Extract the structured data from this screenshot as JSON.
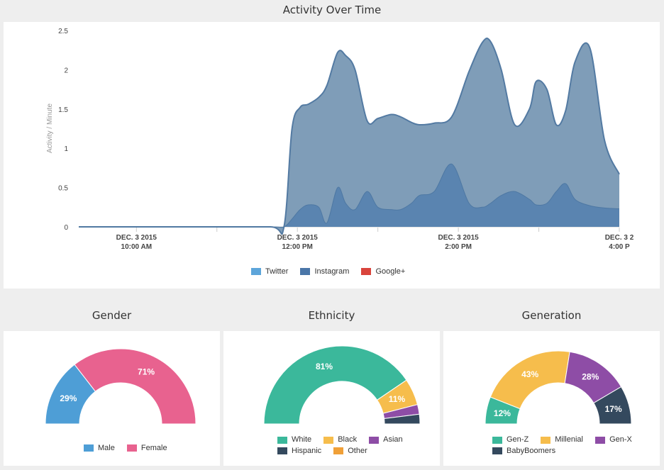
{
  "header": {
    "activity_title": "Activity Over Time"
  },
  "panels": {
    "gender_title": "Gender",
    "ethnicity_title": "Ethnicity",
    "generation_title": "Generation"
  },
  "chart_data": [
    {
      "type": "area",
      "title": "Activity Over Time",
      "ylabel": "Activity / Minute",
      "xlabel": "",
      "ylim": [
        0,
        2.5
      ],
      "yticks": [
        "0",
        "0.5",
        "1",
        "1.5",
        "2",
        "2.5"
      ],
      "xticks": [
        {
          "line1": "DEC. 3 2015",
          "line2": "10:00 AM",
          "t": 0
        },
        {
          "line1": "DEC. 3 2015",
          "line2": "12:00 PM",
          "t": 120
        },
        {
          "line1": "DEC. 3 2015",
          "line2": "2:00 PM",
          "t": 240
        },
        {
          "line1": "DEC. 3 2",
          "line2": "4:00 P",
          "t": 360
        }
      ],
      "x_minutes": [
        -43,
        0,
        50,
        100,
        110,
        116,
        122,
        128,
        136,
        142,
        150,
        156,
        163,
        172,
        180,
        190,
        197,
        205,
        211,
        222,
        235,
        248,
        258,
        264,
        272,
        282,
        293,
        298,
        306,
        313,
        320,
        327,
        338,
        349,
        360
      ],
      "legend": [
        "Twitter",
        "Instagram",
        "Google+"
      ],
      "series": [
        {
          "name": "Twitter",
          "color": "#5DA5DA",
          "values": [
            0,
            0,
            0,
            0,
            0,
            0,
            0,
            0,
            0,
            0,
            0,
            0,
            0,
            0,
            0,
            0,
            0,
            0,
            0,
            0,
            0,
            0,
            0,
            0,
            0,
            0,
            0,
            0,
            0,
            0,
            0,
            0,
            0,
            0,
            0
          ]
        },
        {
          "name": "Instagram",
          "color": "#4A76A8",
          "values": [
            0,
            0,
            0,
            0,
            0,
            0.1,
            0.22,
            0.28,
            0.25,
            0.05,
            0.5,
            0.3,
            0.22,
            0.45,
            0.25,
            0.22,
            0.22,
            0.3,
            0.4,
            0.45,
            0.8,
            0.3,
            0.25,
            0.3,
            0.4,
            0.45,
            0.35,
            0.28,
            0.3,
            0.45,
            0.55,
            0.35,
            0.27,
            0.24,
            0.23
          ]
        },
        {
          "name": "Google+",
          "color": "#D9443C",
          "values": [
            0,
            0,
            0,
            0,
            0,
            0,
            0,
            0,
            0,
            0,
            0,
            0,
            0,
            0,
            0,
            0,
            0,
            0,
            0,
            0,
            0,
            0,
            0,
            0,
            0,
            0,
            0,
            0,
            0,
            0,
            0,
            0,
            0,
            0,
            0
          ]
        }
      ],
      "total": [
        0,
        0,
        0,
        0,
        0,
        1.25,
        1.52,
        1.56,
        1.65,
        1.8,
        2.22,
        2.18,
        2.0,
        1.35,
        1.38,
        1.43,
        1.4,
        1.33,
        1.3,
        1.32,
        1.4,
        1.98,
        2.35,
        2.36,
        2.0,
        1.3,
        1.5,
        1.85,
        1.75,
        1.3,
        1.48,
        2.1,
        2.28,
        1.1,
        0.67
      ]
    },
    {
      "type": "pie",
      "subtype": "semi-donut",
      "title": "Gender",
      "slices": [
        {
          "label": "Male",
          "value": 29,
          "text": "29%",
          "color": "#4E9ED6"
        },
        {
          "label": "Female",
          "value": 71,
          "text": "71%",
          "color": "#E8628F"
        }
      ]
    },
    {
      "type": "pie",
      "subtype": "semi-donut",
      "title": "Ethnicity",
      "slices": [
        {
          "label": "White",
          "value": 81,
          "text": "81%",
          "color": "#3BB89B"
        },
        {
          "label": "Black",
          "value": 11,
          "text": "11%",
          "color": "#F6BD4C"
        },
        {
          "label": "Asian",
          "value": 4,
          "text": "",
          "color": "#8E4DA6"
        },
        {
          "label": "Hispanic",
          "value": 4,
          "text": "",
          "color": "#34495E"
        },
        {
          "label": "Other",
          "value": 0,
          "text": "",
          "color": "#F0A038"
        }
      ]
    },
    {
      "type": "pie",
      "subtype": "semi-donut",
      "title": "Generation",
      "slices": [
        {
          "label": "Gen-Z",
          "value": 12,
          "text": "12%",
          "color": "#3BB89B"
        },
        {
          "label": "Millenial",
          "value": 43,
          "text": "43%",
          "color": "#F6BD4C"
        },
        {
          "label": "Gen-X",
          "value": 28,
          "text": "28%",
          "color": "#8E4DA6"
        },
        {
          "label": "BabyBoomers",
          "value": 17,
          "text": "17%",
          "color": "#34495E"
        }
      ]
    }
  ]
}
